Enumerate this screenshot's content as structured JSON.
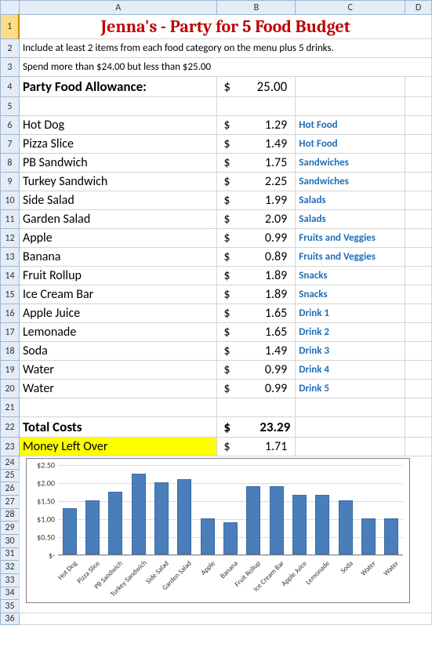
{
  "cols": [
    "A",
    "B",
    "C",
    "D"
  ],
  "rows": 36,
  "title": "Jenna's  - Party for 5 Food Budget",
  "instr1": "Include at least 2 items from each food category on the menu plus 5 drinks.",
  "instr2": "Spend more than $24.00 but less than $25.00",
  "allowance": {
    "label": "Party Food Allowance:",
    "sym": "$",
    "val": "25.00"
  },
  "items": [
    {
      "name": "Hot Dog",
      "sym": "$",
      "price": "1.29",
      "cat": "Hot Food"
    },
    {
      "name": "Pizza Slice",
      "sym": "$",
      "price": "1.49",
      "cat": "Hot Food"
    },
    {
      "name": "PB Sandwich",
      "sym": "$",
      "price": "1.75",
      "cat": "Sandwiches"
    },
    {
      "name": "Turkey Sandwich",
      "sym": "$",
      "price": "2.25",
      "cat": "Sandwiches"
    },
    {
      "name": "Side Salad",
      "sym": "$",
      "price": "1.99",
      "cat": "Salads"
    },
    {
      "name": "Garden Salad",
      "sym": "$",
      "price": "2.09",
      "cat": "Salads"
    },
    {
      "name": "Apple",
      "sym": "$",
      "price": "0.99",
      "cat": "Fruits and Veggies"
    },
    {
      "name": "Banana",
      "sym": "$",
      "price": "0.89",
      "cat": "Fruits and Veggies"
    },
    {
      "name": "Fruit Rollup",
      "sym": "$",
      "price": "1.89",
      "cat": "Snacks"
    },
    {
      "name": "Ice Cream Bar",
      "sym": "$",
      "price": "1.89",
      "cat": "Snacks"
    },
    {
      "name": "Apple Juice",
      "sym": "$",
      "price": "1.65",
      "cat": "Drink 1"
    },
    {
      "name": "Lemonade",
      "sym": "$",
      "price": "1.65",
      "cat": "Drink 2"
    },
    {
      "name": "Soda",
      "sym": "$",
      "price": "1.49",
      "cat": "Drink 3"
    },
    {
      "name": "Water",
      "sym": "$",
      "price": "0.99",
      "cat": "Drink 4"
    },
    {
      "name": "Water",
      "sym": "$",
      "price": "0.99",
      "cat": "Drink 5"
    }
  ],
  "total": {
    "label": "Total Costs",
    "sym": "$",
    "val": "23.29"
  },
  "leftover": {
    "label": "Money Left Over",
    "sym": "$",
    "val": "1.71"
  },
  "chart_data": {
    "type": "bar",
    "categories": [
      "Hot Dog",
      "Pizza Slice",
      "PB Sandwich",
      "Turkey Sandwich",
      "Side Salad",
      "Garden Salad",
      "Apple",
      "Banana",
      "Fruit Rollup",
      "Ice Cream Bar",
      "Apple Juice",
      "Lemonade",
      "Soda",
      "Water",
      "Water"
    ],
    "values": [
      1.29,
      1.49,
      1.75,
      2.25,
      1.99,
      2.09,
      0.99,
      0.89,
      1.89,
      1.89,
      1.65,
      1.65,
      1.49,
      0.99,
      0.99
    ],
    "ylabel": "",
    "xlabel": "",
    "title": "",
    "ylim": [
      0,
      2.5
    ],
    "yticks": [
      "$-",
      "$0.50",
      "$1.00",
      "$1.50",
      "$2.00",
      "$2.50"
    ]
  }
}
